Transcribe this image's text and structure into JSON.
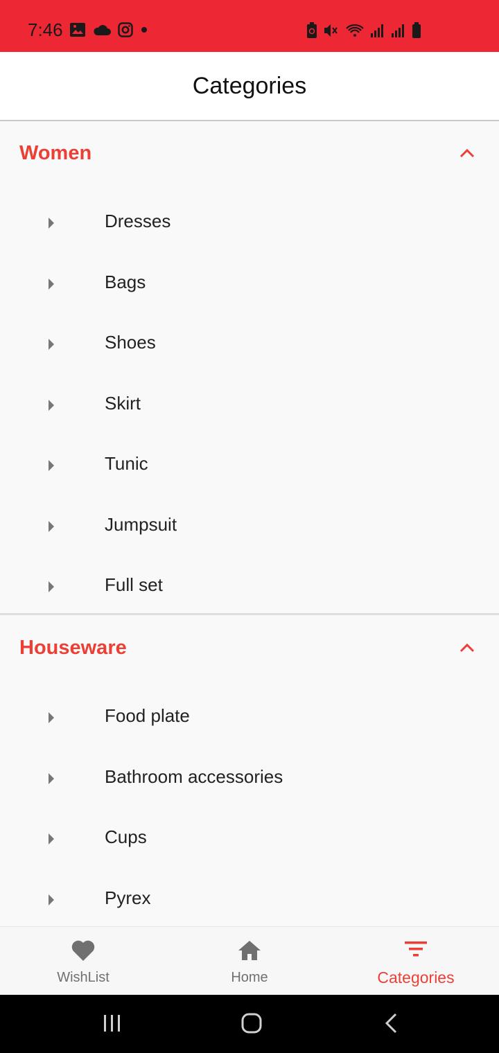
{
  "status_bar": {
    "time": "7:46",
    "left_icons": [
      "gallery-icon",
      "cloud-icon",
      "instagram-icon",
      "dot-icon"
    ],
    "right_icons": [
      "battery-saver-icon",
      "mute-icon",
      "wifi-icon",
      "signal-icon",
      "signal-icon",
      "battery-icon"
    ]
  },
  "header": {
    "title": "Categories"
  },
  "sections": [
    {
      "title": "Women",
      "items": [
        "Dresses",
        "Bags",
        "Shoes",
        "Skirt",
        "Tunic",
        "Jumpsuit",
        "Full set"
      ]
    },
    {
      "title": "Houseware",
      "items": [
        "Food plate",
        "Bathroom accessories",
        "Cups",
        "Pyrex"
      ]
    }
  ],
  "bottom_nav": {
    "items": [
      {
        "label": "WishList",
        "icon": "heart-icon"
      },
      {
        "label": "Home",
        "icon": "home-icon"
      },
      {
        "label": "Categories",
        "icon": "filter-icon",
        "active": true
      }
    ]
  },
  "colors": {
    "accent": "#ec3f35",
    "status_bar": "#ee2734",
    "background": "#f9f9f9"
  }
}
